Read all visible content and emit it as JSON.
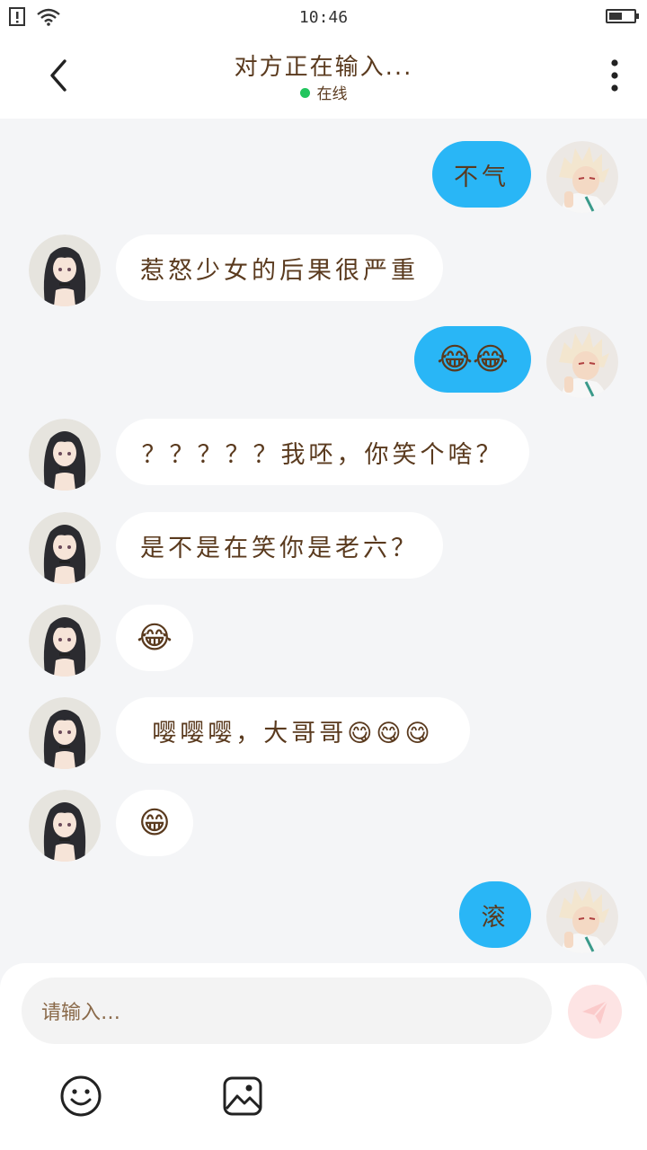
{
  "status_bar": {
    "time": "10:46",
    "battery_level": 0.55
  },
  "header": {
    "title": "对方正在输入...",
    "status": "在线"
  },
  "messages": [
    {
      "side": "out",
      "text": "不气",
      "emoji": false
    },
    {
      "side": "in",
      "text": "惹怒少女的后果很严重",
      "emoji": false
    },
    {
      "side": "out",
      "text": "😂😂",
      "emoji": true
    },
    {
      "side": "in",
      "text": "？？？？？我呸，你笑个啥？",
      "emoji": false
    },
    {
      "side": "in",
      "text": "是不是在笑你是老六？",
      "emoji": false
    },
    {
      "side": "in",
      "text": "😂",
      "emoji": true
    },
    {
      "side": "in",
      "text": "嘤嘤嘤，大哥哥😋😋😋",
      "emoji": false
    },
    {
      "side": "in",
      "text": "😁",
      "emoji": true
    },
    {
      "side": "out",
      "text": "滚",
      "emoji": false
    }
  ],
  "input": {
    "placeholder": "请输入…"
  },
  "icons": {
    "back": "chevron-left-icon",
    "more": "more-vertical-icon",
    "send": "send-icon",
    "emoji": "smile-icon",
    "image": "image-icon"
  },
  "colors": {
    "out_bubble": "#29b6f6",
    "in_bubble": "#ffffff",
    "text": "#5a3a1e",
    "online": "#22c55e",
    "send_button": "#fde4e4"
  }
}
